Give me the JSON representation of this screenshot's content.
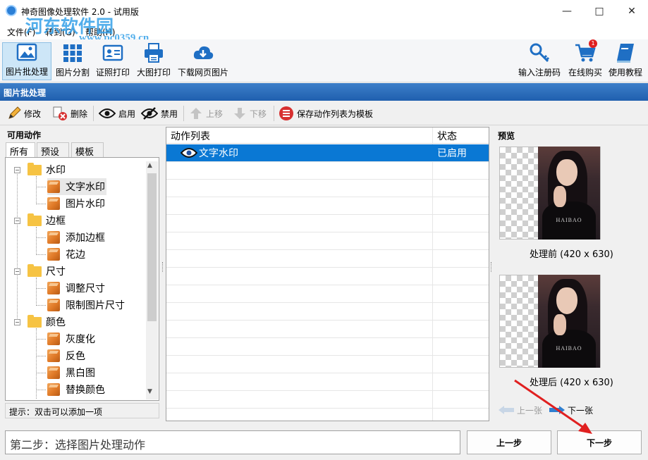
{
  "window": {
    "title": "神奇图像处理软件 2.0 - 试用版",
    "controls": [
      "minimize-icon",
      "maximize-icon",
      "close-icon"
    ]
  },
  "watermark": {
    "text": "河东软件园",
    "url": "www.pc0359.cn"
  },
  "menu": [
    {
      "label": "文件(F)"
    },
    {
      "label": "转到(G)"
    },
    {
      "label": "帮助(H)"
    }
  ],
  "ribbon": {
    "left": [
      {
        "label": "图片批处理",
        "icon": "images-icon",
        "active": true
      },
      {
        "label": "图片分割",
        "icon": "grid-split-icon"
      },
      {
        "label": "证照打印",
        "icon": "id-card-icon"
      },
      {
        "label": "大图打印",
        "icon": "printer-icon"
      },
      {
        "label": "下载网页图片",
        "icon": "cloud-download-icon"
      }
    ],
    "right": [
      {
        "label": "输入注册码",
        "icon": "key-icon"
      },
      {
        "label": "在线购买",
        "icon": "cart-icon",
        "badge": "1"
      },
      {
        "label": "使用教程",
        "icon": "book-icon"
      }
    ]
  },
  "section_title": "图片批处理",
  "toolbar": {
    "edit": "修改",
    "delete": "删除",
    "enable": "启用",
    "disable": "禁用",
    "move_up": "上移",
    "move_down": "下移",
    "save_template": "保存动作列表为模板"
  },
  "actions_panel": {
    "title": "可用动作",
    "tabs": [
      "所有",
      "预设",
      "模板"
    ],
    "tree": [
      {
        "label": "水印",
        "children": [
          "文字水印",
          "图片水印"
        ]
      },
      {
        "label": "边框",
        "children": [
          "添加边框",
          "花边"
        ]
      },
      {
        "label": "尺寸",
        "children": [
          "调整尺寸",
          "限制图片尺寸"
        ]
      },
      {
        "label": "颜色",
        "children": [
          "灰度化",
          "反色",
          "黑白图",
          "替换颜色"
        ]
      }
    ],
    "hint": "提示：双击可以添加一项"
  },
  "action_list": {
    "columns": [
      "动作列表",
      "状态"
    ],
    "rows": [
      {
        "name": "文字水印",
        "status": "已启用"
      }
    ]
  },
  "preview": {
    "title": "预览",
    "before_label": "处理前 (420 x 630)",
    "after_label": "处理后 (420 x 630)",
    "photo_text": "HAIBAO",
    "prev_image": "上一张",
    "next_image": "下一张"
  },
  "footer": {
    "step_text": "第二步：选择图片处理动作",
    "prev_step": "上一步",
    "next_step": "下一步"
  },
  "colors": {
    "accent": "#0a78d4",
    "header_blue": "#1f5fae",
    "annotation_red": "#e02020"
  }
}
